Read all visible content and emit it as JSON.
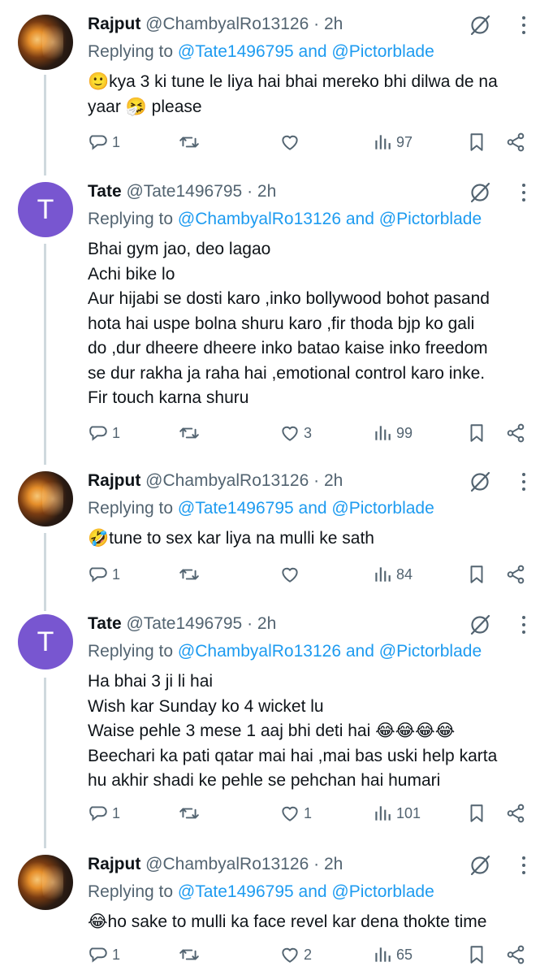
{
  "tweets": [
    {
      "name": "Rajput",
      "handle": "@ChambyalRo13126",
      "dot": "·",
      "time": "2h",
      "replying_prefix": "Replying to",
      "mention1": "@Tate1496795",
      "conj": "and",
      "mention2": "@Pictorblade",
      "avatar": "photo",
      "lines": [
        "🙂kya 3 ki tune le liya hai bhai mereko bhi dilwa de na",
        "yaar 🤧 please"
      ],
      "replies": "1",
      "reposts": "",
      "likes": "",
      "views": "97"
    },
    {
      "name": "Tate",
      "handle": "@Tate1496795",
      "dot": "·",
      "time": "2h",
      "replying_prefix": "Replying to",
      "mention1": "@ChambyalRo13126",
      "conj": "and",
      "mention2": "@Pictorblade",
      "avatar": "letter",
      "avatar_letter": "T",
      "lines": [
        "Bhai gym jao, deo lagao",
        "Achi bike lo",
        "Aur  hijabi se dosti karo ,inko bollywood bohot pasand",
        "hota hai uspe bolna shuru karo ,fir thoda bjp ko gali",
        "do ,dur dheere dheere inko batao kaise inko freedom",
        "se dur rakha ja raha hai ,emotional control karo inke.",
        "Fir touch karna shuru"
      ],
      "replies": "1",
      "reposts": "",
      "likes": "3",
      "views": "99"
    },
    {
      "name": "Rajput",
      "handle": "@ChambyalRo13126",
      "dot": "·",
      "time": "2h",
      "replying_prefix": "Replying to",
      "mention1": "@Tate1496795",
      "conj": "and",
      "mention2": "@Pictorblade",
      "avatar": "photo",
      "lines": [
        "🤣tune to sex kar liya na mulli ke sath"
      ],
      "replies": "1",
      "reposts": "",
      "likes": "",
      "views": "84"
    },
    {
      "name": "Tate",
      "handle": "@Tate1496795",
      "dot": "·",
      "time": "2h",
      "replying_prefix": "Replying to",
      "mention1": "@ChambyalRo13126",
      "conj": "and",
      "mention2": "@Pictorblade",
      "avatar": "letter",
      "avatar_letter": "T",
      "lines": [
        "Ha bhai 3 ji li hai",
        "Wish kar Sunday ko 4 wicket lu",
        "Waise pehle 3 mese 1 aaj bhi deti hai 😂😂😂😂",
        "Beechari ka pati qatar mai hai ,mai bas uski help karta",
        "hu akhir shadi ke pehle se pehchan hai humari"
      ],
      "replies": "1",
      "reposts": "",
      "likes": "1",
      "views": "101"
    },
    {
      "name": "Rajput",
      "handle": "@ChambyalRo13126",
      "dot": "·",
      "time": "2h",
      "replying_prefix": "Replying to",
      "mention1": "@Tate1496795",
      "conj": "and",
      "mention2": "@Pictorblade",
      "avatar": "photo",
      "lines": [
        "😂ho sake to mulli ka face revel kar dena thokte time"
      ],
      "replies": "1",
      "reposts": "",
      "likes": "2",
      "views": "65"
    }
  ],
  "icons": {
    "reply": "reply-icon",
    "repost": "repost-icon",
    "like": "heart-icon",
    "views": "views-icon",
    "bookmark": "bookmark-icon",
    "share": "share-icon",
    "grok": "grok-icon",
    "more": "more-icon"
  },
  "colors": {
    "link": "#1d9bf0",
    "secondary_text": "#536471",
    "letter_avatar": "#7856d0",
    "thread_line": "#cfd9de"
  }
}
